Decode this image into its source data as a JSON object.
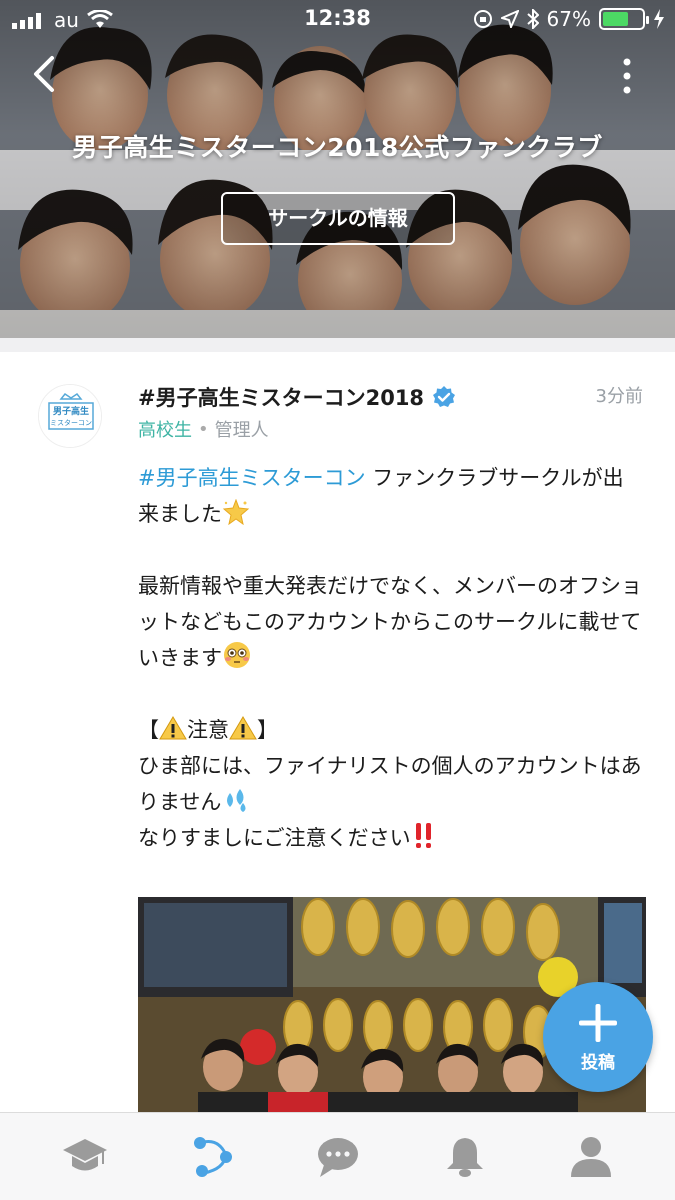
{
  "status_bar": {
    "carrier": "au",
    "time": "12:38",
    "battery_percent": "67%",
    "battery_level": 0.67
  },
  "header": {
    "title": "男子高生ミスターコン2018公式ファンクラブ",
    "circle_info_button": "サークルの情報"
  },
  "post": {
    "author": "#男子高生ミスターコン2018",
    "verified": true,
    "timestamp": "3分前",
    "school": "高校生",
    "separator": "•",
    "role": "管理人",
    "hashtag": "#男子高生ミスターコン",
    "line1_rest": " ファンクラブサークルが出来ました",
    "para2": "最新情報や重大発表だけでなく、メンバーのオフショットなどもこのアカウントからこのサークルに載せていきます",
    "notice_open": "【",
    "notice_word": "注意",
    "notice_close": "】",
    "notice_line1": "ひま部には、ファイナリストの個人のアカウントはありません",
    "notice_line2": "なりすましにご注意ください",
    "avatar_text_line1": "男子高生",
    "avatar_text_line2": "ミスターコン"
  },
  "fab": {
    "label": "投稿"
  },
  "tabs": [
    {
      "icon": "graduation-cap-icon",
      "active": false
    },
    {
      "icon": "circle-network-icon",
      "active": true
    },
    {
      "icon": "chat-bubble-icon",
      "active": false
    },
    {
      "icon": "bell-icon",
      "active": false
    },
    {
      "icon": "profile-icon",
      "active": false
    }
  ],
  "colors": {
    "accent": "#4aa3e4",
    "hashtag": "#2d9bd6",
    "school": "#3fb4a4",
    "muted": "#9aa0a6",
    "tab_inactive": "#9b9b9b",
    "tab_active": "#4aa3e4"
  }
}
